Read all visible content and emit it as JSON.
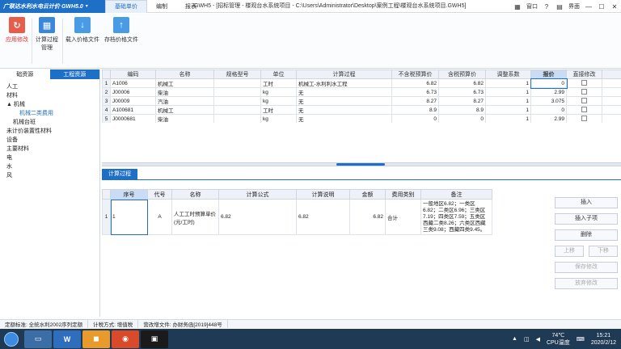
{
  "titlebar": {
    "brand": "广联达水利水电云计价 GWH5.0",
    "menu_tabs": [
      "基础单价",
      "编制",
      "报表"
    ],
    "window_title": "GWH5 - [招标管理 - 楼观台水系统项目 - C:\\Users\\Administrator\\Desktop\\案例工程\\楼观台水系统项目.GWH5]",
    "window_menu": "窗口",
    "ui_label": "界面"
  },
  "ribbon": {
    "buttons": [
      "应用修改",
      "计算过程管理",
      "载入价格文件",
      "存档价格文件"
    ]
  },
  "left_panel": {
    "tabs": [
      "础资源",
      "工程资源"
    ],
    "tree": [
      {
        "label": "人工",
        "level": 0,
        "selected": false
      },
      {
        "label": "材料",
        "level": 0,
        "selected": false
      },
      {
        "label": "▲ 机械",
        "level": 0,
        "selected": false
      },
      {
        "label": "机械二类费用",
        "level": 2,
        "selected": true
      },
      {
        "label": "机械台班",
        "level": 1,
        "selected": false
      },
      {
        "label": "未计价装置性材料",
        "level": 0,
        "selected": false
      },
      {
        "label": "设备",
        "level": 0,
        "selected": false
      },
      {
        "label": "主要材料",
        "level": 0,
        "selected": false
      },
      {
        "label": "电",
        "level": 0,
        "selected": false
      },
      {
        "label": "水",
        "level": 0,
        "selected": false
      },
      {
        "label": "风",
        "level": 0,
        "selected": false
      }
    ]
  },
  "main_grid": {
    "headers": [
      "编码",
      "名称",
      "规格型号",
      "单位",
      "计算过程",
      "不含税预算价",
      "含税预算价",
      "调整系数",
      "报价",
      "直接修改"
    ],
    "rows": [
      [
        "1",
        "A1006",
        "机械工",
        "",
        "工时",
        "机械工-水利利水工程",
        "6.82",
        "6.82",
        "1",
        "0"
      ],
      [
        "2",
        "J00006",
        "柴油",
        "",
        "kg",
        "无",
        "6.73",
        "6.73",
        "1",
        "2.99"
      ],
      [
        "3",
        "J00009",
        "汽油",
        "",
        "kg",
        "无",
        "8.27",
        "8.27",
        "1",
        "3.075"
      ],
      [
        "4",
        "A100681",
        "机械工",
        "",
        "工时",
        "无",
        "8.9",
        "8.9",
        "1",
        "0"
      ],
      [
        "5",
        "J0000681",
        "柴油",
        "",
        "kg",
        "无",
        "0",
        "0",
        "1",
        "2.99"
      ]
    ]
  },
  "bottom_panel": {
    "tab": "计算过程",
    "headers": [
      "序号",
      "代号",
      "名称",
      "计算公式",
      "计算说明",
      "金额",
      "费用类别",
      "备注"
    ],
    "row": {
      "no": "1",
      "seq": "1",
      "code": "A",
      "name": "人工工时预算单价(元/工时)",
      "formula": "6.82",
      "desc": "6.82",
      "amount": "6.82",
      "category": "合计",
      "remarks": [
        "一般地区6.82；一类区",
        "6.82；二类区6.96；三类区",
        "7.19；四类区7.59；五类区",
        "西藏二类8.26；六类区西藏",
        "三类9.08；西藏四类9.45。"
      ]
    },
    "buttons": {
      "insert": "插入",
      "insert_child": "插入子项",
      "delete": "删除",
      "move_up": "上移",
      "move_down": "下移",
      "save_edit": "保存修改",
      "discard_edit": "放弃修改"
    }
  },
  "statusbar": {
    "items": [
      "定额标准: 全统水利2002序列定额",
      "计税方式: 增值税",
      "营改增文件: 办财务函[2019]448号"
    ]
  },
  "taskbar": {
    "temp": "74℃",
    "temp_label": "CPU温度",
    "time": "15:21",
    "date": "2020/2/12"
  },
  "colors": {
    "accent": "#1e6fc6",
    "header_bg": "#eef2f8",
    "taskbar": "#1f3a55"
  }
}
